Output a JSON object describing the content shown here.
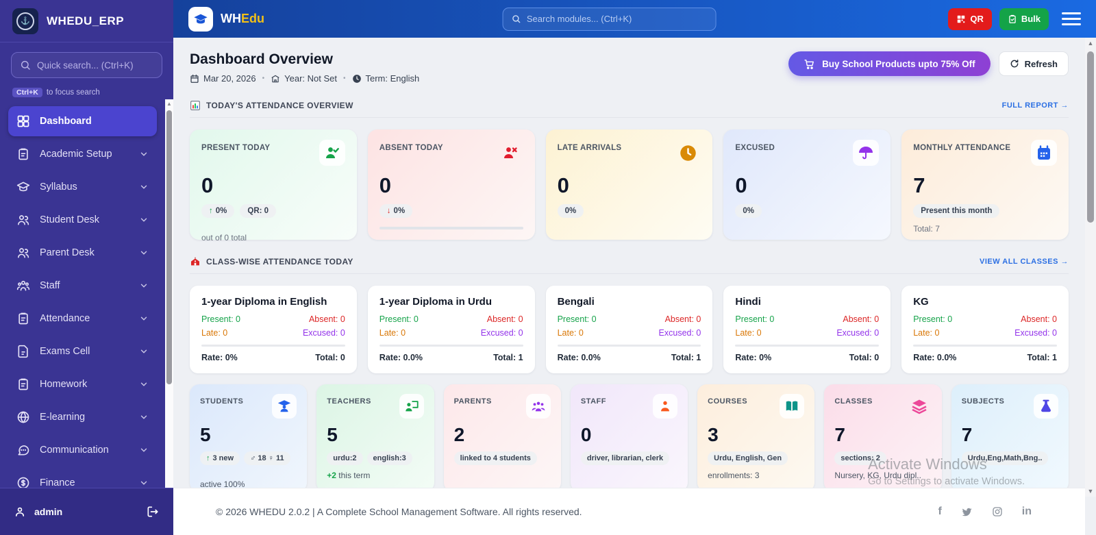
{
  "sidebar": {
    "brand": "WHEDU_ERP",
    "search_placeholder": "Quick search... (Ctrl+K)",
    "hint_key": "Ctrl+K",
    "hint_text": "to focus search",
    "items": [
      {
        "label": "Dashboard",
        "icon": "grid-icon",
        "active": true
      },
      {
        "label": "Academic Setup",
        "icon": "clipboard-icon"
      },
      {
        "label": "Syllabus",
        "icon": "graduation-cap-icon"
      },
      {
        "label": "Student Desk",
        "icon": "users-icon"
      },
      {
        "label": "Parent Desk",
        "icon": "users-icon"
      },
      {
        "label": "Staff",
        "icon": "people-group-icon"
      },
      {
        "label": "Attendance",
        "icon": "clipboard-icon"
      },
      {
        "label": "Exams Cell",
        "icon": "document-icon"
      },
      {
        "label": "Homework",
        "icon": "clipboard-icon"
      },
      {
        "label": "E-learning",
        "icon": "globe-icon"
      },
      {
        "label": "Communication",
        "icon": "chat-icon"
      },
      {
        "label": "Finance",
        "icon": "dollar-circle-icon"
      }
    ],
    "user": "admin"
  },
  "navbar": {
    "brand_primary": "WH",
    "brand_accent": "Edu",
    "search_placeholder": "Search modules... (Ctrl+K)",
    "qr_label": "QR",
    "bulk_label": "Bulk"
  },
  "header": {
    "title": "Dashboard Overview",
    "date": "Mar 20, 2026",
    "year": "Year: Not Set",
    "term": "Term: English",
    "buy_button": "Buy School Products upto 75% Off",
    "refresh_button": "Refresh"
  },
  "attendance": {
    "section_title": "TODAY'S ATTENDANCE OVERVIEW",
    "link": "FULL REPORT →",
    "cards": [
      {
        "label": "PRESENT TODAY",
        "value": "0",
        "trend_arrow": "↑",
        "trend_text": "0%",
        "badge2": "QR: 0",
        "note": "out of 0 total",
        "icon": "person-check-icon",
        "theme": "green"
      },
      {
        "label": "ABSENT TODAY",
        "value": "0",
        "trend_arrow": "↓",
        "trend_text": "0%",
        "icon": "person-x-icon",
        "theme": "red"
      },
      {
        "label": "LATE ARRIVALS",
        "value": "0",
        "badge": "0%",
        "icon": "clock-icon",
        "theme": "yellow"
      },
      {
        "label": "EXCUSED",
        "value": "0",
        "badge": "0%",
        "icon": "umbrella-icon",
        "theme": "blue"
      },
      {
        "label": "MONTHLY ATTENDANCE",
        "value": "7",
        "badge": "Present this month",
        "note": "Total: 7",
        "icon": "calendar-icon",
        "theme": "orange"
      }
    ]
  },
  "classwise": {
    "section_title": "CLASS-WISE ATTENDANCE TODAY",
    "link": "VIEW ALL CLASSES →",
    "cards": [
      {
        "name": "1-year Diploma in English",
        "present": "Present: 0",
        "absent": "Absent: 0",
        "late": "Late: 0",
        "excused": "Excused: 0",
        "rate": "Rate: 0%",
        "total": "Total: 0"
      },
      {
        "name": "1-year Diploma in Urdu",
        "present": "Present: 0",
        "absent": "Absent: 0",
        "late": "Late: 0",
        "excused": "Excused: 0",
        "rate": "Rate: 0.0%",
        "total": "Total: 1"
      },
      {
        "name": "Bengali",
        "present": "Present: 0",
        "absent": "Absent: 0",
        "late": "Late: 0",
        "excused": "Excused: 0",
        "rate": "Rate: 0.0%",
        "total": "Total: 1"
      },
      {
        "name": "Hindi",
        "present": "Present: 0",
        "absent": "Absent: 0",
        "late": "Late: 0",
        "excused": "Excused: 0",
        "rate": "Rate: 0%",
        "total": "Total: 0"
      },
      {
        "name": "KG",
        "present": "Present: 0",
        "absent": "Absent: 0",
        "late": "Late: 0",
        "excused": "Excused: 0",
        "rate": "Rate: 0.0%",
        "total": "Total: 1"
      }
    ]
  },
  "stats": {
    "cards": [
      {
        "label": "STUDENTS",
        "value": "5",
        "trend_arrow": "↑",
        "trend_text": "3 new",
        "badge2": "♂ 18 ♀ 11",
        "note": "active 100%",
        "icon": "student-icon",
        "theme": "blue"
      },
      {
        "label": "TEACHERS",
        "value": "5",
        "badge1": "urdu:2",
        "badge2": "english:3",
        "note_highlight": "+2",
        "note_rest": " this term",
        "icon": "teacher-board-icon",
        "theme": "green"
      },
      {
        "label": "PARENTS",
        "value": "2",
        "badge": "linked to 4 students",
        "icon": "family-group-icon",
        "theme": "pink"
      },
      {
        "label": "STAFF",
        "value": "0",
        "badge": "driver, librarian, clerk",
        "icon": "person-icon",
        "theme": "lavender"
      },
      {
        "label": "COURSES",
        "value": "3",
        "badge": "Urdu, English, Gen",
        "note": "enrollments: 3",
        "icon": "open-book-icon",
        "theme": "peach"
      },
      {
        "label": "CLASSES",
        "value": "7",
        "badge": "sections: 2",
        "note": "Nursery, KG, Urdu dipl..",
        "icon": "layers-icon",
        "theme": "rose"
      },
      {
        "label": "SUBJECTS",
        "value": "7",
        "badge": "Urdu,Eng,Math,Bng..",
        "icon": "flask-icon",
        "theme": "sky"
      }
    ]
  },
  "footer": {
    "copyright": "© 2026 WHEDU 2.0.2 | A Complete School Management Software. All rights reserved.",
    "social_icons": [
      "facebook-icon",
      "twitter-icon",
      "instagram-icon",
      "linkedin-icon"
    ],
    "facebook_glyph": "f",
    "linkedin_glyph": "in"
  },
  "watermark": {
    "line1": "Activate Windows",
    "line2": "Go to Settings to activate Windows."
  },
  "colors": {
    "sidebar_bg": "#3a3493",
    "sidebar_active": "#4b44cf",
    "navbar_gradient_start": "#15419c",
    "navbar_gradient_end": "#1a6ae2",
    "brand_accent_yellow": "#f2c017",
    "qr_red": "#e31b1b",
    "bulk_green": "#14a348",
    "buy_gradient_start": "#6459e5",
    "buy_gradient_end": "#8e40d4",
    "link_blue": "#2b6fe3",
    "present_green": "#16a34a",
    "absent_red": "#dc2626",
    "late_orange": "#d97706",
    "excused_purple": "#9333ea",
    "students_bar_blue": "#17507d"
  }
}
